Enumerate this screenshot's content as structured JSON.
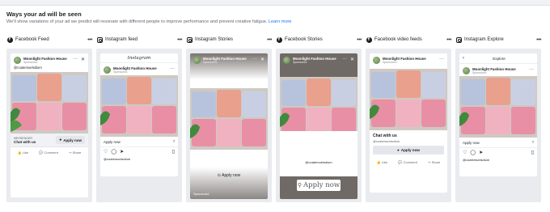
{
  "header": {
    "title": "Ways your ad will be seen",
    "description": "We'll show variations of your ad we predict will resonate with different people to improve performance and prevent creative fatigue.",
    "learn_more": "Learn more"
  },
  "placements": [
    {
      "label": "Facebook Feed",
      "icon": "facebook-icon"
    },
    {
      "label": "Instagram feed",
      "icon": "instagram-icon"
    },
    {
      "label": "Instagram Stories",
      "icon": "instagram-icon"
    },
    {
      "label": "Facebook Stories",
      "icon": "facebook-icon"
    },
    {
      "label": "Facebook video feeds",
      "icon": "facebook-icon"
    },
    {
      "label": "Instagram Explore",
      "icon": "instagram-icon"
    }
  ],
  "ad": {
    "page_name": "Moonlight Fashion House",
    "sponsored": "Sponsored",
    "handle": "@coatemuelsdium",
    "cta": "Apply now",
    "instagram_logo": "Instagram",
    "explore_title": "Explore",
    "messenger_label": "MESSENGER",
    "chat_label": "Chat with us",
    "like": "Like",
    "comment": "Comment",
    "share": "Share",
    "story_sponsored": "Sponsored"
  },
  "colors": {
    "accent": "#1877f2",
    "shirt_pink": "#e88fa6",
    "shirt_blue": "#b7c3dc",
    "shirt_peach": "#e9a08d",
    "story_dark": "#6f6a66"
  }
}
